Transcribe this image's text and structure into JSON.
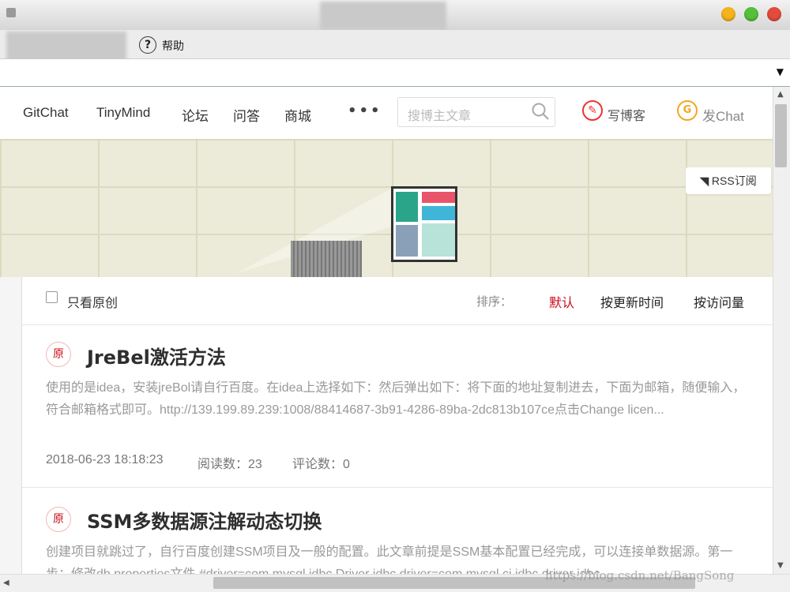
{
  "window": {
    "help_label": "帮助"
  },
  "nav": {
    "items": [
      "GitChat",
      "TinyMind",
      "论坛",
      "问答",
      "商城"
    ],
    "more": "•••",
    "search_placeholder": "搜博主文章",
    "write_label": "写博客",
    "chat_icon_letter": "G",
    "chat_label": "发Chat"
  },
  "banner": {
    "rss_label": "RSS订阅"
  },
  "filter": {
    "only_original": "只看原创",
    "sort_label": "排序：",
    "sort_default": "默认",
    "sort_update": "按更新时间",
    "sort_visits": "按访问量"
  },
  "articles": [
    {
      "badge": "原",
      "title": "JreBel激活方法",
      "desc": "使用的是idea，安装jreBol请自行百度。在idea上选择如下：然后弹出如下：将下面的地址复制进去，下面为邮箱，随便输入，符合邮箱格式即可。http://139.199.89.239:1008/88414687-3b91-4286-89ba-2dc813b107ce点击Change licen...",
      "date": "2018-06-23 18:18:23",
      "reads": "阅读数：23",
      "comments": "评论数：0"
    },
    {
      "badge": "原",
      "title": "SSM多数据源注解动态切换",
      "desc": "创建项目就跳过了，自行百度创建SSM项目及一般的配置。此文章前提是SSM基本配置已经完成，可以连接单数据源。第一步：修改db.properties文件 #driver=com.mysql.jdbc.Driver jdbc.driver=com.mysql.cj.jdbc.driver jdbc"
    }
  ],
  "watermark": "https://blog.csdn.net/BangSong",
  "colors": {
    "accent_red": "#ca0c16",
    "chat_orange": "#f5a623"
  }
}
